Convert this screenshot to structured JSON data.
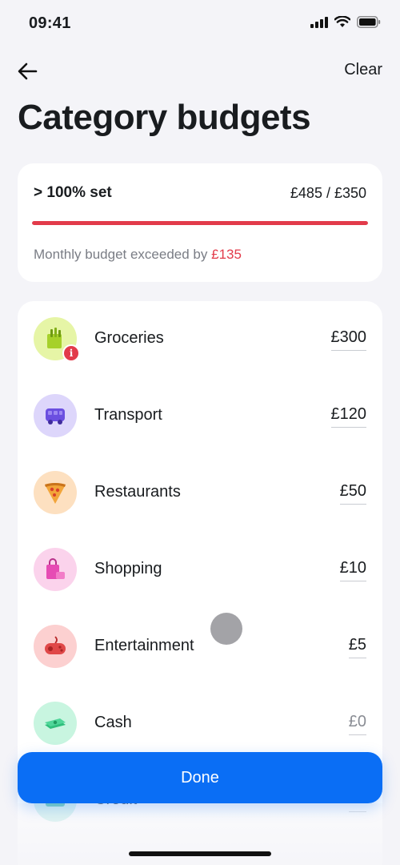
{
  "status_bar": {
    "time": "09:41"
  },
  "nav": {
    "clear_label": "Clear"
  },
  "page": {
    "title": "Category budgets"
  },
  "summary": {
    "percent_label": "> 100% set",
    "amount_label": "£485 / £350",
    "progress_fraction": 1.0,
    "message_prefix": "Monthly budget exceeded by ",
    "message_amount": "£135",
    "accent_color": "#e23b4a"
  },
  "categories": [
    {
      "name": "Groceries",
      "amount": "£300",
      "icon": "groceries-bag-icon",
      "icon_bg": "#e6f5a6",
      "alert": "i"
    },
    {
      "name": "Transport",
      "amount": "£120",
      "icon": "bus-icon",
      "icon_bg": "#ddd6fb"
    },
    {
      "name": "Restaurants",
      "amount": "£50",
      "icon": "pizza-slice-icon",
      "icon_bg": "#fde0c0"
    },
    {
      "name": "Shopping",
      "amount": "£10",
      "icon": "shopping-bag-icon",
      "icon_bg": "#fbd3ec"
    },
    {
      "name": "Entertainment",
      "amount": "£5",
      "icon": "game-controller-icon",
      "icon_bg": "#fcd0d0"
    },
    {
      "name": "Cash",
      "amount": "£0",
      "icon": "cash-icon",
      "icon_bg": "#c8f5e0"
    },
    {
      "name": "Credit",
      "amount": "£0",
      "icon": "credit-icon",
      "icon_bg": "#c8f0ea"
    }
  ],
  "done_button": {
    "label": "Done",
    "color": "#0a6ef5"
  }
}
